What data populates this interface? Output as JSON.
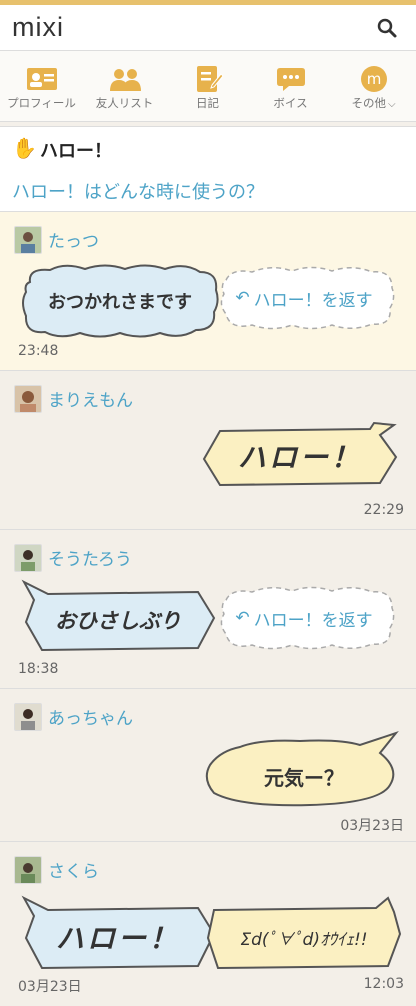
{
  "header": {
    "logo": "mixi"
  },
  "nav": [
    {
      "label": "プロフィール",
      "icon": "profile-card-icon"
    },
    {
      "label": "友人リスト",
      "icon": "friends-icon"
    },
    {
      "label": "日記",
      "icon": "diary-icon"
    },
    {
      "label": "ボイス",
      "icon": "voice-icon"
    },
    {
      "label": "その他",
      "icon": "more-icon",
      "badge": "m"
    }
  ],
  "page": {
    "title": "ハロー！",
    "help_link": "ハロー！はどんな時に使うの？"
  },
  "reply_label": "ハロー！を返す",
  "entries": [
    {
      "user": "たっつ",
      "message": "おつかれさまです",
      "time": "23:48"
    },
    {
      "user": "まりえもん",
      "message": "ハロー！",
      "time": "22:29"
    },
    {
      "user": "そうたろう",
      "message": "おひさしぶり",
      "time": "18:38"
    },
    {
      "user": "あっちゃん",
      "message": "元気ー？",
      "time": "03月23日"
    },
    {
      "user": "さくら",
      "message": "ハロー！",
      "reply_message": "Σd(ﾟ∀ﾟd)ｵｳｲｪ!!",
      "time_left": "03月23日",
      "time_right": "12:03"
    }
  ],
  "colors": {
    "accent": "#e7c16d",
    "link": "#4da3c7",
    "bubble_blue": "#dcecf5",
    "bubble_yellow": "#fbf0c2"
  }
}
